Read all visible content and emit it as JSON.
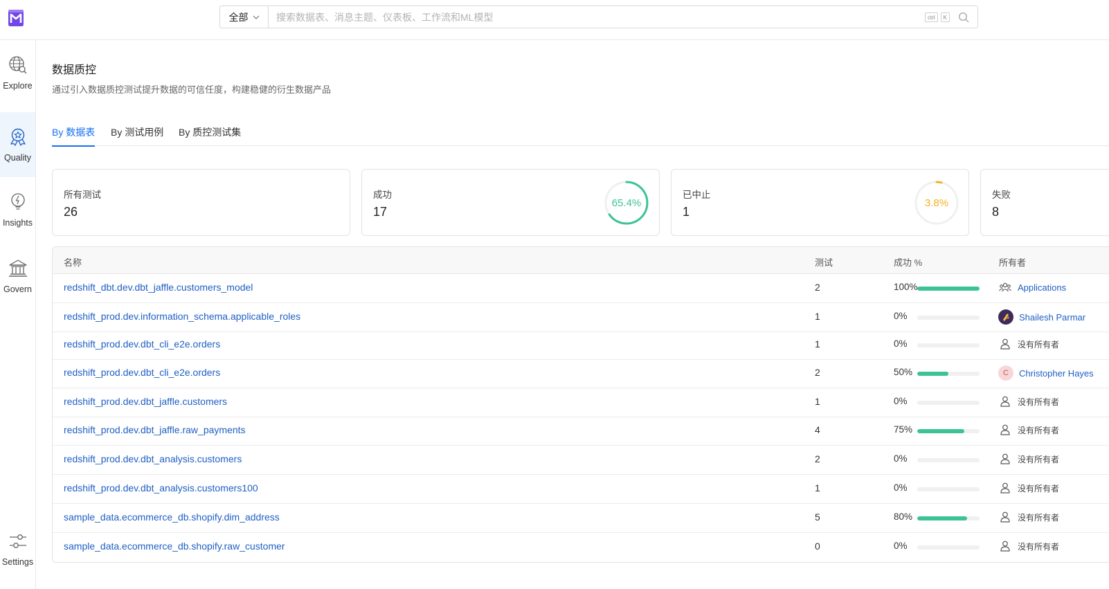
{
  "header": {
    "search_scope": "全部",
    "search_placeholder": "搜索数据表、消息主题、仪表板、工作流和ML模型",
    "shortcut_ctrl": "ctrl",
    "shortcut_k": "K"
  },
  "sidebar": {
    "items": [
      {
        "label": "Explore",
        "icon": "explore-globe-icon",
        "active": false
      },
      {
        "label": "Quality",
        "icon": "quality-badge-icon",
        "active": true
      },
      {
        "label": "Insights",
        "icon": "insights-bulb-icon",
        "active": false
      },
      {
        "label": "Govern",
        "icon": "govern-bank-icon",
        "active": false
      }
    ],
    "settings_label": "Settings"
  },
  "page": {
    "title": "数据质控",
    "description": "通过引入数据质控测试提升数据的可信任度，构建稳健的衍生数据产品"
  },
  "tabs": [
    {
      "label": "By 数据表",
      "active": true
    },
    {
      "label": "By 测试用例",
      "active": false
    },
    {
      "label": "By 质控测试集",
      "active": false
    }
  ],
  "summary": {
    "all": {
      "label": "所有测试",
      "value": "26"
    },
    "success": {
      "label": "成功",
      "value": "17",
      "percent_text": "65.4%",
      "percent": 65.4,
      "color": "#3cc393"
    },
    "aborted": {
      "label": "已中止",
      "value": "1",
      "percent_text": "3.8%",
      "percent": 3.8,
      "color": "#f5b120"
    },
    "failed": {
      "label": "失败",
      "value": "8"
    }
  },
  "table": {
    "headers": {
      "name": "名称",
      "tests": "测试",
      "success": "成功 %",
      "owner": "所有者"
    },
    "rows": [
      {
        "name": "redshift_dbt.dev.dbt_jaffle.customers_model",
        "tests": "2",
        "pct_text": "100%",
        "pct": 100,
        "owner": "Applications",
        "owner_type": "team"
      },
      {
        "name": "redshift_prod.dev.information_schema.applicable_roles",
        "tests": "1",
        "pct_text": "0%",
        "pct": 0,
        "owner": "Shailesh Parmar",
        "owner_type": "user-image"
      },
      {
        "name": "redshift_prod.dev.dbt_cli_e2e.orders",
        "tests": "1",
        "pct_text": "0%",
        "pct": 0,
        "owner": "没有所有者",
        "owner_type": "none"
      },
      {
        "name": "redshift_prod.dev.dbt_cli_e2e.orders",
        "tests": "2",
        "pct_text": "50%",
        "pct": 50,
        "owner": "Christopher Hayes",
        "owner_type": "user-initial",
        "initial": "C"
      },
      {
        "name": "redshift_prod.dev.dbt_jaffle.customers",
        "tests": "1",
        "pct_text": "0%",
        "pct": 0,
        "owner": "没有所有者",
        "owner_type": "none"
      },
      {
        "name": "redshift_prod.dev.dbt_jaffle.raw_payments",
        "tests": "4",
        "pct_text": "75%",
        "pct": 75,
        "owner": "没有所有者",
        "owner_type": "none"
      },
      {
        "name": "redshift_prod.dev.dbt_analysis.customers",
        "tests": "2",
        "pct_text": "0%",
        "pct": 0,
        "owner": "没有所有者",
        "owner_type": "none"
      },
      {
        "name": "redshift_prod.dev.dbt_analysis.customers100",
        "tests": "1",
        "pct_text": "0%",
        "pct": 0,
        "owner": "没有所有者",
        "owner_type": "none"
      },
      {
        "name": "sample_data.ecommerce_db.shopify.dim_address",
        "tests": "5",
        "pct_text": "80%",
        "pct": 80,
        "owner": "没有所有者",
        "owner_type": "none"
      },
      {
        "name": "sample_data.ecommerce_db.shopify.raw_customer",
        "tests": "0",
        "pct_text": "0%",
        "pct": 0,
        "owner": "没有所有者",
        "owner_type": "none"
      }
    ]
  },
  "colors": {
    "accent": "#1470ef",
    "link": "#1f5fc4",
    "success": "#3cc393",
    "warning": "#f5b120",
    "logo": "#7147e8"
  }
}
